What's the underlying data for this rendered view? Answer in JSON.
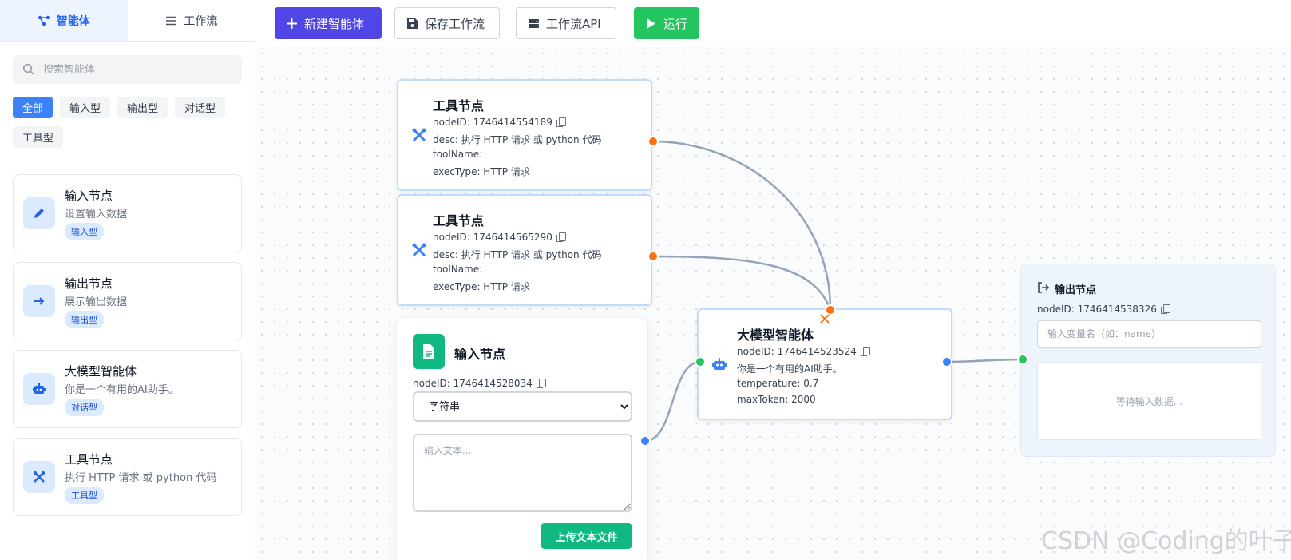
{
  "sidebar": {
    "tabs": [
      {
        "label": "智能体",
        "icon": "agent-network-icon",
        "active": true
      },
      {
        "label": "工作流",
        "icon": "list-icon",
        "active": false
      }
    ],
    "search": {
      "placeholder": "搜索智能体"
    },
    "filters": [
      "全部",
      "输入型",
      "输出型",
      "对话型",
      "工具型"
    ],
    "cards": [
      {
        "title": "输入节点",
        "desc": "设置输入数据",
        "badge": "输入型",
        "icon": "pencil-icon"
      },
      {
        "title": "输出节点",
        "desc": "展示输出数据",
        "badge": "输出型",
        "icon": "arrow-right-icon"
      },
      {
        "title": "大模型智能体",
        "desc": "你是一个有用的AI助手。",
        "badge": "对话型",
        "icon": "robot-icon"
      },
      {
        "title": "工具节点",
        "desc": "执行 HTTP 请求 或 python 代码",
        "badge": "工具型",
        "icon": "tools-icon"
      }
    ]
  },
  "toolbar": {
    "new_agent": "新建智能体",
    "save_workflow": "保存工作流",
    "workflow_api": "工作流API",
    "run": "运行"
  },
  "nodes": {
    "tool1": {
      "title": "工具节点",
      "node_id": "nodeID: 1746414554189",
      "desc": "desc: 执行 HTTP 请求 或 python 代码",
      "tool_name": "toolName:",
      "exec_type": "execType: HTTP 请求"
    },
    "tool2": {
      "title": "工具节点",
      "node_id": "nodeID: 1746414565290",
      "desc": "desc: 执行 HTTP 请求 或 python 代码",
      "tool_name": "toolName:",
      "exec_type": "execType: HTTP 请求"
    },
    "input": {
      "title": "输入节点",
      "node_id": "nodeID: 1746414528034",
      "type_selected": "字符串",
      "text_placeholder": "输入文本...",
      "upload_label": "上传文本文件"
    },
    "llm": {
      "title": "大模型智能体",
      "node_id": "nodeID: 1746414523524",
      "prompt": "你是一个有用的AI助手。",
      "temperature": "temperature: 0.7",
      "max_token": "maxToken: 2000"
    },
    "output": {
      "title": "输出节点",
      "node_id": "nodeID: 1746414538326",
      "var_placeholder": "输入变量名（如：name）",
      "waiting": "等待输入数据..."
    }
  },
  "colors": {
    "primary": "#4f46e5",
    "run": "#22c55e",
    "accent_blue": "#3b82f6",
    "handle_orange": "#f97316",
    "edge": "#94a3b8"
  },
  "watermark": "CSDN @Coding的叶子"
}
